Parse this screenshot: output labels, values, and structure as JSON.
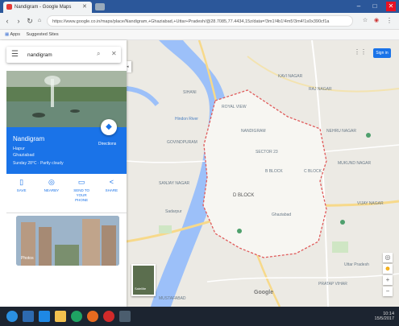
{
  "browser": {
    "tab_title": "Nandigram - Google Maps",
    "url": "https://www.google.co.in/maps/place/Nandigram,+Ghaziabad,+Uttar+Pradesh/@28.7085,77.4434,15z/data=!3m1!4b1!4m5!3m4!1s0x390cf1a",
    "bookmarks": [
      "Apps",
      "Suggested Sites"
    ]
  },
  "sidepanel": {
    "search_value": "nandigram",
    "place_title": "Nandigram",
    "place_sub1": "Hapur",
    "place_sub2": "Ghaziabad",
    "weather": "Sunday 28°C · Partly cloudy",
    "directions_label": "Directions",
    "actions": [
      {
        "icon": "save-icon",
        "label": "SAVE"
      },
      {
        "icon": "nearby-icon",
        "label": "NEARBY"
      },
      {
        "icon": "send-to-phone-icon",
        "label": "SEND TO YOUR PHONE"
      },
      {
        "icon": "share-icon",
        "label": "SHARE"
      }
    ],
    "photo_label": "Photos"
  },
  "map": {
    "sign_in": "Sign in",
    "labels": [
      "KAVI NAGAR",
      "SIHANI",
      "ROYAL VIEW",
      "RAJ NAGAR",
      "NEHRU NAGAR",
      "NANDIGRAM",
      "SECTOR 23",
      "MUKUND NAGAR",
      "GOVINDPURAM",
      "SANJAY NAGAR",
      "VIJAY NAGAR",
      "Sadarpur",
      "B BLOCK",
      "C BLOCK",
      "D BLOCK",
      "Uttar Pradesh",
      "Ghaziabad",
      "Hindon River",
      "PRATAP VIHAR",
      "MUSTAFABAD"
    ],
    "satellite_label": "Satellite",
    "google": "Google"
  },
  "taskbar": {
    "time": "10:14",
    "date": "15/5/2017"
  },
  "colors": {
    "accent": "#1a73e8",
    "taskbar": "#1c2430",
    "boundary": "#e05a5a",
    "river": "#9cc0f9"
  }
}
